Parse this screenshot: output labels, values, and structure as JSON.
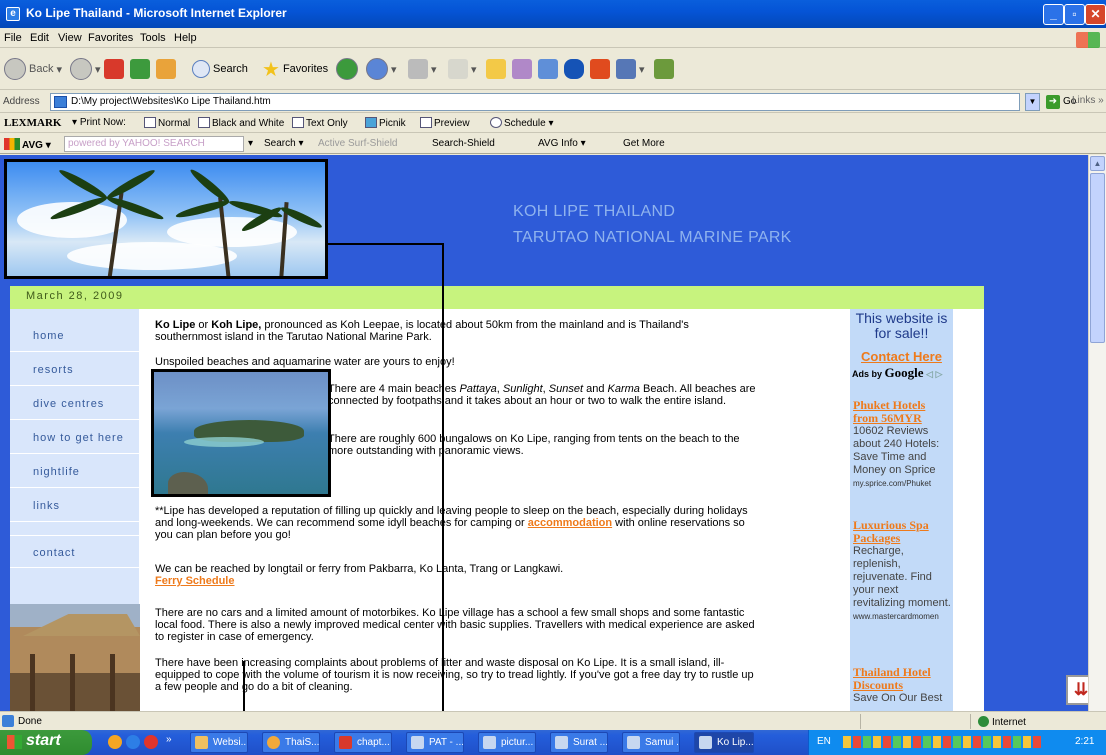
{
  "window": {
    "title": "Ko Lipe Thailand - Microsoft Internet Explorer"
  },
  "menu": [
    "File",
    "Edit",
    "View",
    "Favorites",
    "Tools",
    "Help"
  ],
  "toolbar": {
    "back": "Back",
    "search": "Search",
    "favorites": "Favorites"
  },
  "address": {
    "label": "Address",
    "value": "D:\\My project\\Websites\\Ko Lipe Thailand.htm",
    "go": "Go",
    "links": "Links"
  },
  "lexmark": {
    "brand": "LEXMARK",
    "print_now": "Print Now:",
    "normal": "Normal",
    "bw": "Black and White",
    "text_only": "Text Only",
    "picnik": "Picnik",
    "preview": "Preview",
    "schedule": "Schedule"
  },
  "avg": {
    "brand": "AVG",
    "yahoo": "powered by YAHOO! SEARCH",
    "search": "Search",
    "active": "Active",
    "surf_shield": "Surf-Shield",
    "search_shield": "Search-Shield",
    "avg_info": "AVG Info",
    "get_more": "Get More"
  },
  "page": {
    "title_line1": "KOH LIPE THAILAND",
    "title_line2": "TARUTAO NATIONAL MARINE PARK",
    "date": "March 28, 2009",
    "nav": [
      "home",
      "resorts",
      "dive centres",
      "how to get here",
      "nightlife",
      "links",
      "contact"
    ],
    "content": {
      "p1_b1": "Ko Lipe",
      "p1_or": " or ",
      "p1_b2": "Koh Lipe,",
      "p1_rest": " pronounced as Koh Leepae, is located about 50km from the mainland and is Thailand's southernmost island in the Tarutao National Marine Park.",
      "p2": "Unspoiled beaches and aquamarine water are yours to enjoy!",
      "p3_a": "There are 4 main beaches ",
      "p3_pattaya": "Pattaya",
      "p3_c1": ", ",
      "p3_sunlight": "Sunlight",
      "p3_c2": ", ",
      "p3_sunset": "Sunset",
      "p3_and": " and ",
      "p3_karma": "Karma",
      "p3_b": " Beach. All beaches are connected by footpaths and it takes about an hour or two to walk the entire island.",
      "p4": "There are roughly 600 bungalows on Ko Lipe, ranging from tents on the beach to the more outstanding with panoramic views.",
      "p5_a": "**Lipe has developed a reputation of filling up quickly and leaving people to sleep on the beach, especially during holidays and long-weekends. We can recommend some idyll beaches for camping or ",
      "p5_link": "accommodation",
      "p5_b": " with online reservations so you can plan before you go!",
      "p6": "We can be reached by longtail or ferry from Pakbarra, Ko Lanta, Trang or Langkawi.",
      "p6_link": "Ferry Schedule",
      "p7": "There are no cars and a limited amount of motorbikes. Ko Lipe village has a school a few small shops and some fantastic local food. There is also a newly improved medical center with basic supplies. Travellers with medical experience are asked to register in case of emergency.",
      "p8": "There have been increasing complaints about problems of litter and waste disposal on Ko Lipe. It is a small island, ill-equipped to cope with the volume of tourism it is now receiving, so try to tread lightly. If you've got a free day try to rustle up a few people and go do a bit of cleaning."
    },
    "ads": {
      "forsale": "This website is for sale!!",
      "contact": "Contact Here",
      "adsby": "Ads by",
      "google": "Google",
      "items": [
        {
          "title": "Phuket Hotels from 56MYR",
          "body": "10602 Reviews about 240 Hotels: Save Time and Money on Sprice",
          "url": "my.sprice.com/Phuket"
        },
        {
          "title": "Luxurious Spa Packages",
          "body": "Recharge, replenish, rejuvenate. Find your next revitalizing moment.",
          "url": "www.mastercardmomen"
        },
        {
          "title": "Thailand Hotel Discounts",
          "body": "Save On Our Best",
          "url": ""
        }
      ]
    }
  },
  "status": {
    "text": "Done",
    "zone": "Internet"
  },
  "taskbar": {
    "start": "start",
    "tasks": [
      "Websi...",
      "ThaiS...",
      "chapt...",
      "PAT - ...",
      "pictur...",
      "Surat ...",
      "Samui ...",
      "Ko Lip..."
    ],
    "lang": "EN",
    "clock": "2:21"
  },
  "colors": {
    "page_bg": "#2e5bd8",
    "date_bar": "#c7f37e",
    "nav_bg": "#d9e6fb",
    "link": "#ee7a1b",
    "ads_bg": "#c2daf8"
  }
}
